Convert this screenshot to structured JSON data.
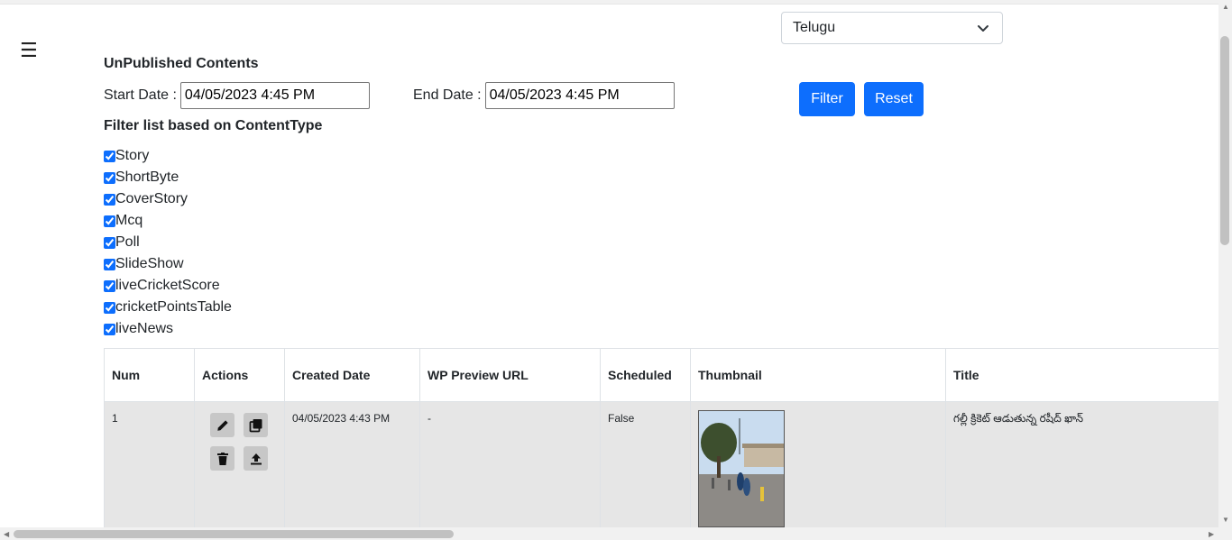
{
  "language_select": {
    "selected": "Telugu"
  },
  "menu_icon": "☰",
  "page_title": "UnPublished Contents",
  "start_date": {
    "label": "Start Date :",
    "value": "04/05/2023 4:45 PM"
  },
  "end_date": {
    "label": "End Date :",
    "value": "04/05/2023 4:45 PM"
  },
  "buttons": {
    "filter": "Filter",
    "reset": "Reset"
  },
  "filter_title": "Filter list based on ContentType",
  "content_types": [
    "Story",
    "ShortByte",
    "CoverStory",
    "Mcq",
    "Poll",
    "SlideShow",
    "liveCricketScore",
    "cricketPointsTable",
    "liveNews"
  ],
  "table": {
    "headers": [
      "Num",
      "Actions",
      "Created Date",
      "WP Preview URL",
      "Scheduled",
      "Thumbnail",
      "Title"
    ],
    "rows": [
      {
        "num": "1",
        "created": "04/05/2023 4:43 PM",
        "wp_url": "-",
        "scheduled": "False",
        "title": "గల్లీ క్రికెట్ ఆడుతున్న రషీద్ ఖాన్"
      }
    ]
  },
  "icons": {
    "menu": "hamburger-icon",
    "dropdown": "chevron-down-icon",
    "edit": "pencil-icon",
    "copy": "copy-icon",
    "delete": "trash-icon",
    "publish": "upload-icon"
  },
  "colors": {
    "primary": "#0d6efd",
    "row_bg": "#e6e6e6"
  }
}
